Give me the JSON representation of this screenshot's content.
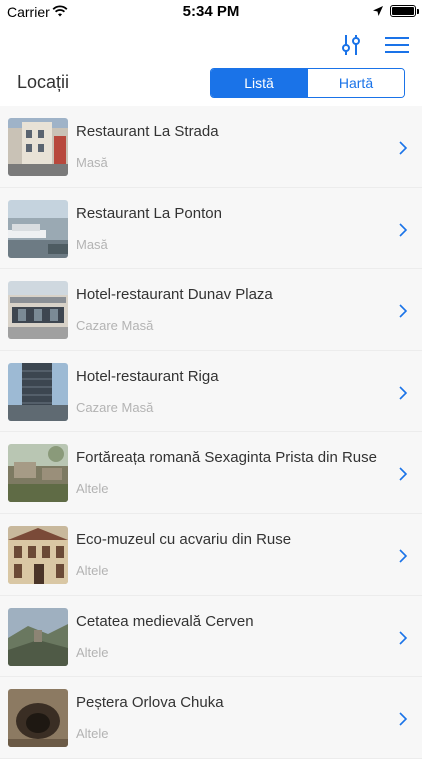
{
  "status_bar": {
    "carrier": "Carrier",
    "time": "5:34 PM"
  },
  "nav": {
    "title": "Locații"
  },
  "segmented": {
    "list_label": "Listă",
    "map_label": "Hartă",
    "selected": "Listă"
  },
  "colors": {
    "accent": "#1a73e8",
    "subtitle": "#b3b3b3",
    "chevron": "#1a73e8"
  },
  "items": [
    {
      "title": "Restaurant  La Strada",
      "subtitle": "Masă",
      "thumb": "restaurant-building-photo"
    },
    {
      "title": "Restaurant  La Ponton",
      "subtitle": "Masă",
      "thumb": "river-pontoon-photo"
    },
    {
      "title": "Hotel-restaurant  Dunav Plaza",
      "subtitle": "Cazare Masă",
      "thumb": "hotel-building-photo"
    },
    {
      "title": "Hotel-restaurant  Riga",
      "subtitle": "Cazare Masă",
      "thumb": "tower-hotel-photo"
    },
    {
      "title": "Fortăreața romană Sexaginta Prista din Ruse",
      "subtitle": "Altele",
      "thumb": "roman-fortress-ruins-photo"
    },
    {
      "title": "Eco-muzeul cu acvariu din Ruse",
      "subtitle": "Altele",
      "thumb": "museum-facade-photo"
    },
    {
      "title": "Cetatea medievală Cerven",
      "subtitle": "Altele",
      "thumb": "medieval-fortress-landscape-photo"
    },
    {
      "title": "Peștera Orlova Chuka",
      "subtitle": "Altele",
      "thumb": "cave-entrance-photo"
    }
  ]
}
